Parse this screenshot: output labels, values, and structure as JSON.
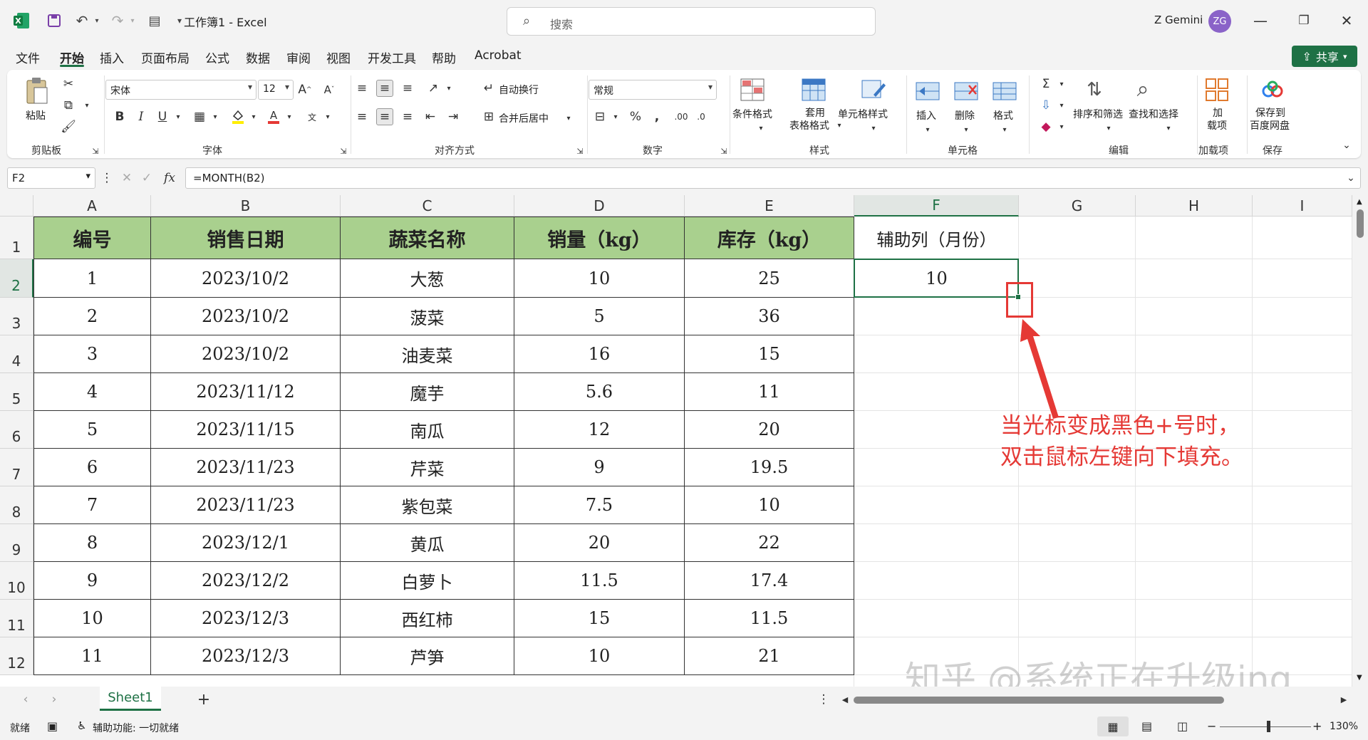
{
  "titlebar": {
    "title": "工作簿1 - Excel",
    "search_placeholder": "搜索",
    "user_name": "Z Gemini",
    "avatar_initials": "ZG"
  },
  "tabs": [
    "文件",
    "开始",
    "插入",
    "页面布局",
    "公式",
    "数据",
    "审阅",
    "视图",
    "开发工具",
    "帮助",
    "Acrobat"
  ],
  "active_tab": "开始",
  "share_label": "共享",
  "ribbon": {
    "paste": "粘贴",
    "clipboard": "剪贴板",
    "font_name": "宋体",
    "font_size": "12",
    "font_group": "字体",
    "bold": "B",
    "italic": "I",
    "underline": "U",
    "wrap_text": "自动换行",
    "merge_center": "合并后居中",
    "alignment_group": "对齐方式",
    "number_format": "常规",
    "number_group": "数字",
    "conditional_format": "条件格式",
    "table_format_1": "套用",
    "table_format_2": "表格格式",
    "cell_styles": "单元格样式",
    "styles_group": "样式",
    "insert": "插入",
    "delete": "删除",
    "format": "格式",
    "cells_group": "单元格",
    "sort_filter": "排序和筛选",
    "find_select": "查找和选择",
    "editing_group": "编辑",
    "addins_1": "加",
    "addins_2": "载项",
    "addins_group": "加载项",
    "save_baidu_1": "保存到",
    "save_baidu_2": "百度网盘",
    "save_group": "保存"
  },
  "formula_bar": {
    "name_box": "F2",
    "formula": "=MONTH(B2)"
  },
  "columns": [
    "A",
    "B",
    "C",
    "D",
    "E",
    "F",
    "G",
    "H",
    "I"
  ],
  "rows": [
    "1",
    "2",
    "3",
    "4",
    "5",
    "6",
    "7",
    "8",
    "9",
    "10",
    "11",
    "12"
  ],
  "table": {
    "headers": [
      "编号",
      "销售日期",
      "蔬菜名称",
      "销量（kg）",
      "库存（kg）"
    ],
    "helper_header": "辅助列（月份）",
    "rows": [
      [
        "1",
        "2023/10/2",
        "大葱",
        "10",
        "25"
      ],
      [
        "2",
        "2023/10/2",
        "菠菜",
        "5",
        "36"
      ],
      [
        "3",
        "2023/10/2",
        "油麦菜",
        "16",
        "15"
      ],
      [
        "4",
        "2023/11/12",
        "魔芋",
        "5.6",
        "11"
      ],
      [
        "5",
        "2023/11/15",
        "南瓜",
        "12",
        "20"
      ],
      [
        "6",
        "2023/11/23",
        "芹菜",
        "9",
        "19.5"
      ],
      [
        "7",
        "2023/11/23",
        "紫包菜",
        "7.5",
        "10"
      ],
      [
        "8",
        "2023/12/1",
        "黄瓜",
        "20",
        "22"
      ],
      [
        "9",
        "2023/12/2",
        "白萝卜",
        "11.5",
        "17.4"
      ],
      [
        "10",
        "2023/12/3",
        "西红柿",
        "15",
        "11.5"
      ],
      [
        "11",
        "2023/12/3",
        "芦笋",
        "10",
        "21"
      ]
    ],
    "f2_value": "10"
  },
  "annotation": {
    "line1": "当光标变成黑色+号时，",
    "line2": "双击鼠标左键向下填充。",
    "color": "#e53935"
  },
  "watermark": "知乎 @系统正在升级ing",
  "sheet_tab": "Sheet1",
  "add_sheet": "+",
  "status": {
    "ready": "就绪",
    "accessibility": "辅助功能: 一切就绪",
    "zoom": "130%"
  },
  "colors": {
    "accent": "#1e7145",
    "header_fill": "#a9d08e"
  }
}
